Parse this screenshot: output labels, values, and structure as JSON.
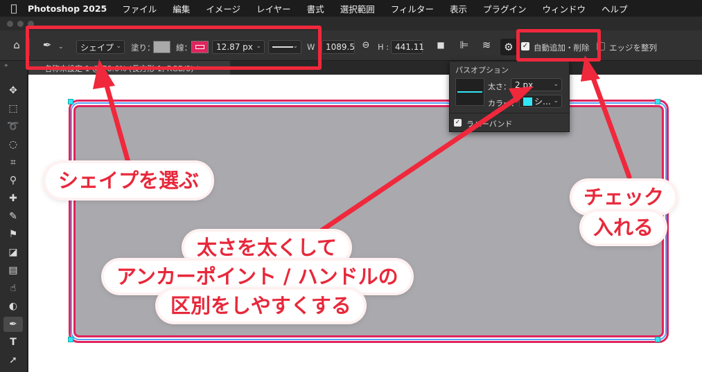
{
  "menubar": {
    "app": "Photoshop 2025",
    "items": [
      "ファイル",
      "編集",
      "イメージ",
      "レイヤー",
      "書式",
      "選択範囲",
      "フィルター",
      "表示",
      "プラグイン",
      "ウィンドウ",
      "ヘルプ"
    ]
  },
  "options_bar": {
    "mode_value": "シェイプ",
    "fill_label": "塗り：",
    "stroke_label": "線：",
    "stroke_width": "12.87 px",
    "w_label": "W",
    "w_value": "1089.5",
    "h_label": "H :",
    "h_value": "441.11",
    "auto_add_delete_label": "自動追加・削除",
    "align_edges_label": "エッジを整列",
    "auto_add_delete_checked": true,
    "align_edges_checked": false
  },
  "document_tab": {
    "title": "名称未設定 1 @ 78.6% (長方形 1, RGB/8) *"
  },
  "path_options": {
    "title": "パスオプション",
    "thickness_label": "太さ：",
    "thickness_value": "2 px",
    "color_label": "カラー：",
    "color_value": "シ…",
    "color_hex": "#33e6f5",
    "rubber_band_label": "ラバーバンド",
    "rubber_band_checked": true
  },
  "callouts": {
    "select_shape": "シェイプを選ぶ",
    "thicken_line1": "太さを太くして",
    "thicken_line2": "アンカーポイント / ハンドルの",
    "thicken_line3": "区別をしやすくする",
    "check_line1": "チェック",
    "check_line2": "入れる"
  },
  "colors": {
    "annotation_red": "#f0283c",
    "shape_fill": "#aaa9ae",
    "shape_stroke": "#e0245e",
    "path_color": "#33e6f5"
  }
}
